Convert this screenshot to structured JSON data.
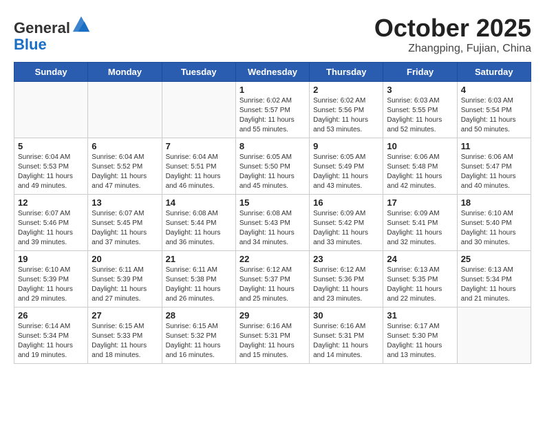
{
  "header": {
    "logo_line1": "General",
    "logo_line2": "Blue",
    "month_title": "October 2025",
    "location": "Zhangping, Fujian, China"
  },
  "weekdays": [
    "Sunday",
    "Monday",
    "Tuesday",
    "Wednesday",
    "Thursday",
    "Friday",
    "Saturday"
  ],
  "weeks": [
    [
      {
        "day": "",
        "info": ""
      },
      {
        "day": "",
        "info": ""
      },
      {
        "day": "",
        "info": ""
      },
      {
        "day": "1",
        "info": "Sunrise: 6:02 AM\nSunset: 5:57 PM\nDaylight: 11 hours\nand 55 minutes."
      },
      {
        "day": "2",
        "info": "Sunrise: 6:02 AM\nSunset: 5:56 PM\nDaylight: 11 hours\nand 53 minutes."
      },
      {
        "day": "3",
        "info": "Sunrise: 6:03 AM\nSunset: 5:55 PM\nDaylight: 11 hours\nand 52 minutes."
      },
      {
        "day": "4",
        "info": "Sunrise: 6:03 AM\nSunset: 5:54 PM\nDaylight: 11 hours\nand 50 minutes."
      }
    ],
    [
      {
        "day": "5",
        "info": "Sunrise: 6:04 AM\nSunset: 5:53 PM\nDaylight: 11 hours\nand 49 minutes."
      },
      {
        "day": "6",
        "info": "Sunrise: 6:04 AM\nSunset: 5:52 PM\nDaylight: 11 hours\nand 47 minutes."
      },
      {
        "day": "7",
        "info": "Sunrise: 6:04 AM\nSunset: 5:51 PM\nDaylight: 11 hours\nand 46 minutes."
      },
      {
        "day": "8",
        "info": "Sunrise: 6:05 AM\nSunset: 5:50 PM\nDaylight: 11 hours\nand 45 minutes."
      },
      {
        "day": "9",
        "info": "Sunrise: 6:05 AM\nSunset: 5:49 PM\nDaylight: 11 hours\nand 43 minutes."
      },
      {
        "day": "10",
        "info": "Sunrise: 6:06 AM\nSunset: 5:48 PM\nDaylight: 11 hours\nand 42 minutes."
      },
      {
        "day": "11",
        "info": "Sunrise: 6:06 AM\nSunset: 5:47 PM\nDaylight: 11 hours\nand 40 minutes."
      }
    ],
    [
      {
        "day": "12",
        "info": "Sunrise: 6:07 AM\nSunset: 5:46 PM\nDaylight: 11 hours\nand 39 minutes."
      },
      {
        "day": "13",
        "info": "Sunrise: 6:07 AM\nSunset: 5:45 PM\nDaylight: 11 hours\nand 37 minutes."
      },
      {
        "day": "14",
        "info": "Sunrise: 6:08 AM\nSunset: 5:44 PM\nDaylight: 11 hours\nand 36 minutes."
      },
      {
        "day": "15",
        "info": "Sunrise: 6:08 AM\nSunset: 5:43 PM\nDaylight: 11 hours\nand 34 minutes."
      },
      {
        "day": "16",
        "info": "Sunrise: 6:09 AM\nSunset: 5:42 PM\nDaylight: 11 hours\nand 33 minutes."
      },
      {
        "day": "17",
        "info": "Sunrise: 6:09 AM\nSunset: 5:41 PM\nDaylight: 11 hours\nand 32 minutes."
      },
      {
        "day": "18",
        "info": "Sunrise: 6:10 AM\nSunset: 5:40 PM\nDaylight: 11 hours\nand 30 minutes."
      }
    ],
    [
      {
        "day": "19",
        "info": "Sunrise: 6:10 AM\nSunset: 5:39 PM\nDaylight: 11 hours\nand 29 minutes."
      },
      {
        "day": "20",
        "info": "Sunrise: 6:11 AM\nSunset: 5:39 PM\nDaylight: 11 hours\nand 27 minutes."
      },
      {
        "day": "21",
        "info": "Sunrise: 6:11 AM\nSunset: 5:38 PM\nDaylight: 11 hours\nand 26 minutes."
      },
      {
        "day": "22",
        "info": "Sunrise: 6:12 AM\nSunset: 5:37 PM\nDaylight: 11 hours\nand 25 minutes."
      },
      {
        "day": "23",
        "info": "Sunrise: 6:12 AM\nSunset: 5:36 PM\nDaylight: 11 hours\nand 23 minutes."
      },
      {
        "day": "24",
        "info": "Sunrise: 6:13 AM\nSunset: 5:35 PM\nDaylight: 11 hours\nand 22 minutes."
      },
      {
        "day": "25",
        "info": "Sunrise: 6:13 AM\nSunset: 5:34 PM\nDaylight: 11 hours\nand 21 minutes."
      }
    ],
    [
      {
        "day": "26",
        "info": "Sunrise: 6:14 AM\nSunset: 5:34 PM\nDaylight: 11 hours\nand 19 minutes."
      },
      {
        "day": "27",
        "info": "Sunrise: 6:15 AM\nSunset: 5:33 PM\nDaylight: 11 hours\nand 18 minutes."
      },
      {
        "day": "28",
        "info": "Sunrise: 6:15 AM\nSunset: 5:32 PM\nDaylight: 11 hours\nand 16 minutes."
      },
      {
        "day": "29",
        "info": "Sunrise: 6:16 AM\nSunset: 5:31 PM\nDaylight: 11 hours\nand 15 minutes."
      },
      {
        "day": "30",
        "info": "Sunrise: 6:16 AM\nSunset: 5:31 PM\nDaylight: 11 hours\nand 14 minutes."
      },
      {
        "day": "31",
        "info": "Sunrise: 6:17 AM\nSunset: 5:30 PM\nDaylight: 11 hours\nand 13 minutes."
      },
      {
        "day": "",
        "info": ""
      }
    ]
  ]
}
